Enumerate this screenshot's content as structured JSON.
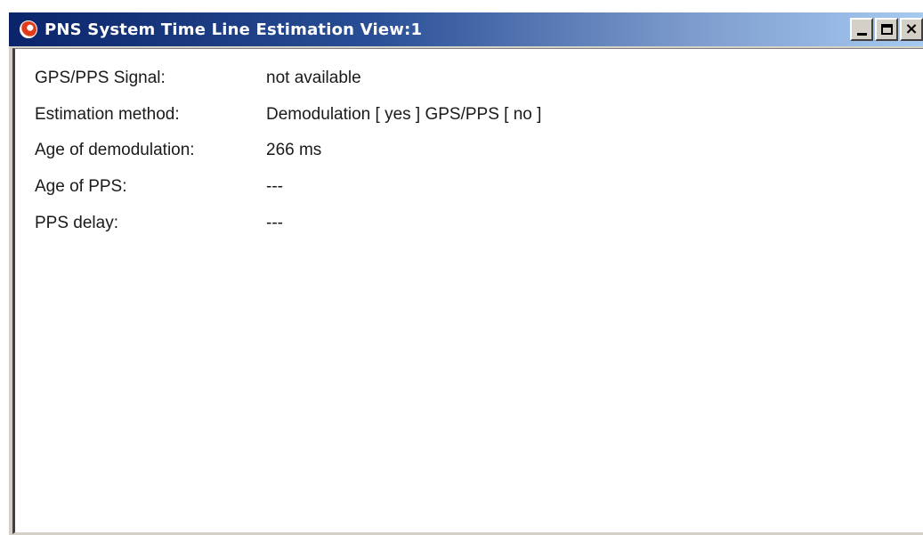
{
  "window": {
    "title": "PNS System Time Line Estimation View:1",
    "icon": "pns-app-icon",
    "controls": {
      "minimize_icon": "minimize-icon",
      "maximize_icon": "maximize-icon",
      "close_label": "×"
    }
  },
  "fields": [
    {
      "label": "GPS/PPS Signal:",
      "value": "not available"
    },
    {
      "label": "Estimation method:",
      "value": "Demodulation [ yes ] GPS/PPS [ no ]"
    },
    {
      "label": "Age of demodulation:",
      "value": "266 ms"
    },
    {
      "label": "Age of PPS:",
      "value": "---"
    },
    {
      "label": "PPS delay:",
      "value": "---"
    }
  ],
  "colors": {
    "titlebar_start": "#0a246a",
    "titlebar_end": "#a6caf0",
    "frame": "#d4d0c8",
    "client_bg": "#ffffff"
  }
}
